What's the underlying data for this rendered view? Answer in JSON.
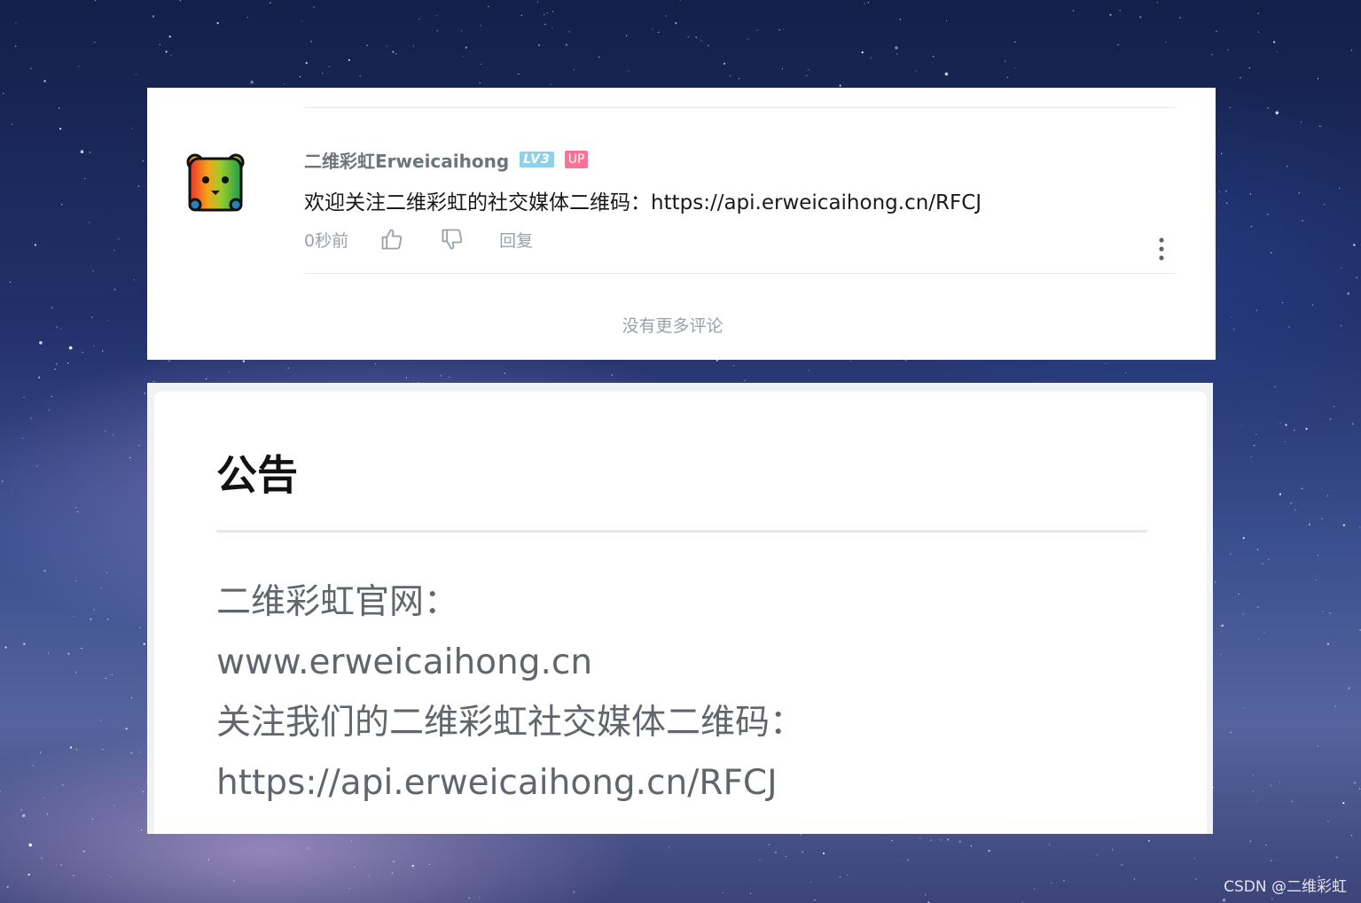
{
  "comment": {
    "username": "二维彩虹Erweicaihong",
    "level_badge": "LV3",
    "up_badge": "UP",
    "text": "欢迎关注二维彩虹的社交媒体二维码：https://api.erweicaihong.cn/RFCJ",
    "time": "0秒前",
    "like_icon": "thumbs-up-icon",
    "dislike_icon": "thumbs-down-icon",
    "reply_label": "回复",
    "more_icon": "more-vertical-icon",
    "no_more_text": "没有更多评论"
  },
  "notice": {
    "title": "公告",
    "lines": [
      "二维彩虹官网：",
      "www.erweicaihong.cn",
      "关注我们的二维彩虹社交媒体二维码：",
      "https://api.erweicaihong.cn/RFCJ"
    ]
  },
  "watermark": "CSDN @二维彩虹",
  "colors": {
    "up_badge": "#fb7299",
    "level_badge": "#8fd0ea",
    "muted_text": "#99a2aa",
    "card_bg": "#ffffff"
  }
}
